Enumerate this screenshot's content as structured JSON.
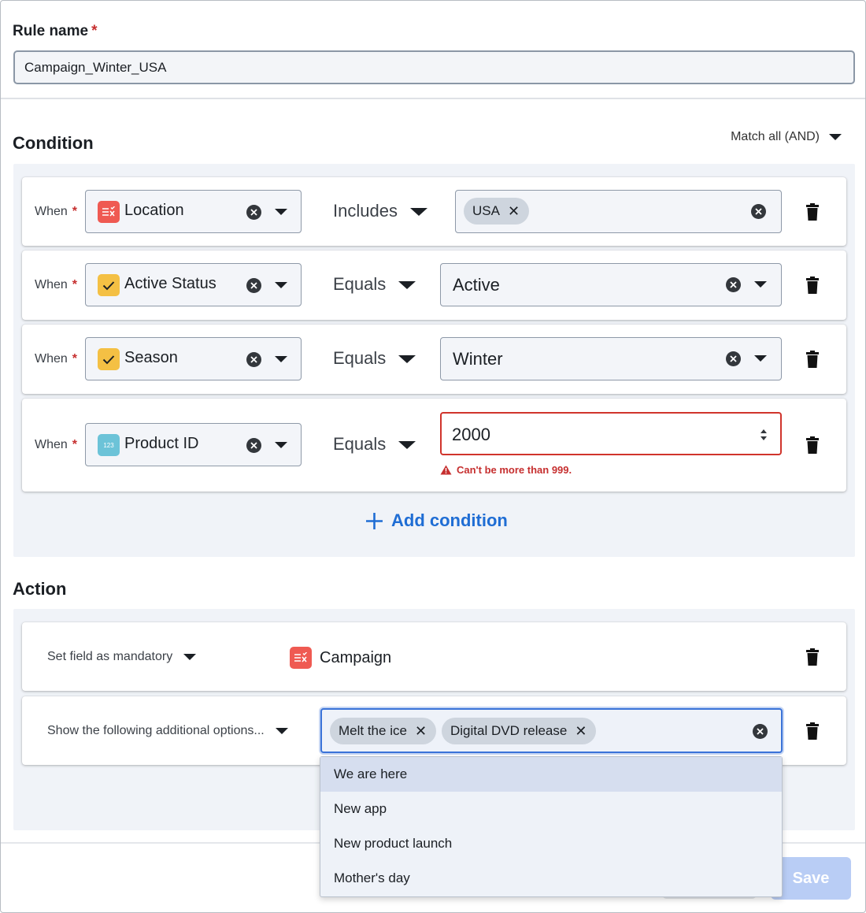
{
  "rule_name": {
    "label": "Rule name",
    "required_mark": "*",
    "value": "Campaign_Winter_USA"
  },
  "condition": {
    "title": "Condition",
    "match_mode": "Match all (AND)",
    "rows": [
      {
        "when_label": "When",
        "required_mark": "*",
        "field": "Location",
        "field_icon": "multi-select-icon",
        "icon_color": "#ef5a52",
        "operator": "Includes",
        "chips": [
          "USA"
        ]
      },
      {
        "when_label": "When",
        "required_mark": "*",
        "field": "Active Status",
        "field_icon": "checkbox-icon",
        "icon_color": "#f4c044",
        "operator": "Equals",
        "value": "Active"
      },
      {
        "when_label": "When",
        "required_mark": "*",
        "field": "Season",
        "field_icon": "checkbox-icon",
        "icon_color": "#f4c044",
        "operator": "Equals",
        "value": "Winter"
      },
      {
        "when_label": "When",
        "required_mark": "*",
        "field": "Product ID",
        "field_icon": "number-icon",
        "icon_color": "#6cc3d8",
        "icon_text": "123",
        "operator": "Equals",
        "value": "2000",
        "error": "Can't be more than 999."
      }
    ],
    "add_label": "Add condition"
  },
  "action": {
    "title": "Action",
    "rows": [
      {
        "action": "Set field as mandatory",
        "field": "Campaign",
        "field_icon": "multi-select-icon"
      },
      {
        "action": "Show the following additional options...",
        "chips": [
          "Melt the ice",
          "Digital DVD release"
        ]
      }
    ],
    "dropdown_options": [
      "We are here",
      "New app",
      "New product launch",
      "Mother's day"
    ]
  },
  "footer": {
    "save_label": "Save"
  },
  "colors": {
    "accent": "#1f6dd4",
    "error": "#c62f2f",
    "panel": "#f0f3f8"
  }
}
